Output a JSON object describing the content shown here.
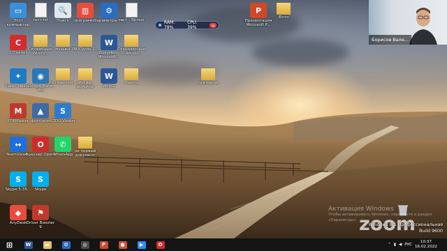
{
  "desktop_icons": [
    {
      "name": "this-pc",
      "label": "Этот компьютер",
      "kind": "pc"
    },
    {
      "name": "textfile-1",
      "label": "тест.txt",
      "kind": "file"
    },
    {
      "name": "search",
      "label": "Поиск",
      "kind": "search"
    },
    {
      "name": "programs",
      "label": "программы",
      "kind": "books"
    },
    {
      "name": "pc-settings",
      "label": "Параметры ПК",
      "kind": "gear"
    },
    {
      "name": "test-label",
      "label": "тест - Ярлык",
      "kind": "file"
    },
    {
      "name": "ccleaner",
      "label": "CCleaner",
      "kind": "ccleaner"
    },
    {
      "name": "service-apps",
      "label": "Служебные-Windo...",
      "kind": "folder"
    },
    {
      "name": "music",
      "label": "музыка",
      "kind": "folder"
    },
    {
      "name": "gkh-folder",
      "label": "ЛКХ урок 1...",
      "kind": "folder"
    },
    {
      "name": "doc-microsoft",
      "label": "Документ Microsoft...",
      "kind": "word"
    },
    {
      "name": "standard-windows",
      "label": "Стандартные — Windo...",
      "kind": "folder"
    },
    {
      "name": "clean-master",
      "label": "Clean Master",
      "kind": "cleanmaster"
    },
    {
      "name": "google-earth",
      "label": "Google Earth Pro",
      "kind": "earth"
    },
    {
      "name": "from-phone",
      "label": "со смартфо...",
      "kind": "folder"
    },
    {
      "name": "shared-iryskoy",
      "label": "общие - ирмской",
      "kind": "folder"
    },
    {
      "name": "word-2",
      "label": "Word2",
      "kind": "word"
    },
    {
      "name": "files",
      "label": "Файлы",
      "kind": "folder"
    },
    {
      "name": "pdfmaster",
      "label": "PDFMaster",
      "kind": "pdf"
    },
    {
      "name": "photo-mom",
      "label": "фото мом",
      "kind": "photo"
    },
    {
      "name": "stdu-viewer",
      "label": "STDU Viewer",
      "kind": "stdu"
    },
    {
      "name": "teamviewer",
      "label": "TeamViewer",
      "kind": "teamviewer"
    },
    {
      "name": "opera",
      "label": "Браузер Opera",
      "kind": "opera"
    },
    {
      "name": "whatsapp",
      "label": "WhatsApp",
      "kind": "whatsapp"
    },
    {
      "name": "new-doc",
      "label": "не первый документ",
      "kind": "folder"
    },
    {
      "name": "skype-old",
      "label": "Skype 5.35...",
      "kind": "skype"
    },
    {
      "name": "skype",
      "label": "Skype",
      "kind": "skype"
    },
    {
      "name": "anydesk",
      "label": "AnyDesk",
      "kind": "anydesk"
    },
    {
      "name": "driver-booster",
      "label": "Driver Booster 9",
      "kind": "driver"
    },
    {
      "name": "presentation",
      "label": "Презентация Microsoft P...",
      "kind": "ppt"
    },
    {
      "name": "photo",
      "label": "Фото",
      "kind": "folder"
    },
    {
      "name": "primetov",
      "label": "примеров",
      "kind": "folder"
    }
  ],
  "sysmon": {
    "ram": "RAM: 79%",
    "cpu": "CPU: 39%",
    "up": "up"
  },
  "zoom_video": {
    "participant": "Борисов Вале..."
  },
  "watermark": {
    "line1": "Активация Windows",
    "line2": "Чтобы активировать Windows, перейдите в раздел «Параметры»."
  },
  "zoom_logo": "zoom",
  "build": {
    "line1": "Windows 8.1 Профессиональная",
    "line2": "Build 9600"
  },
  "taskbar": {
    "apps": [
      {
        "name": "start-button",
        "kind": "start"
      },
      {
        "name": "word-taskbar",
        "kind": "word"
      },
      {
        "name": "explorer-taskbar",
        "kind": "explorer"
      },
      {
        "name": "settings-taskbar",
        "kind": "gear"
      },
      {
        "name": "compass-taskbar",
        "kind": "compass"
      },
      {
        "name": "powerpoint-taskbar",
        "kind": "ppt"
      },
      {
        "name": "chrome-taskbar",
        "kind": "chrome"
      },
      {
        "name": "zoom-taskbar",
        "kind": "zoom"
      },
      {
        "name": "opera-taskbar",
        "kind": "opera"
      }
    ],
    "lang": "РУС",
    "time": "10:37",
    "date": "16.02.2022"
  },
  "colors": {
    "accent": "#2d8cff",
    "taskbar": "#141414",
    "folder": "#e9c25c"
  }
}
